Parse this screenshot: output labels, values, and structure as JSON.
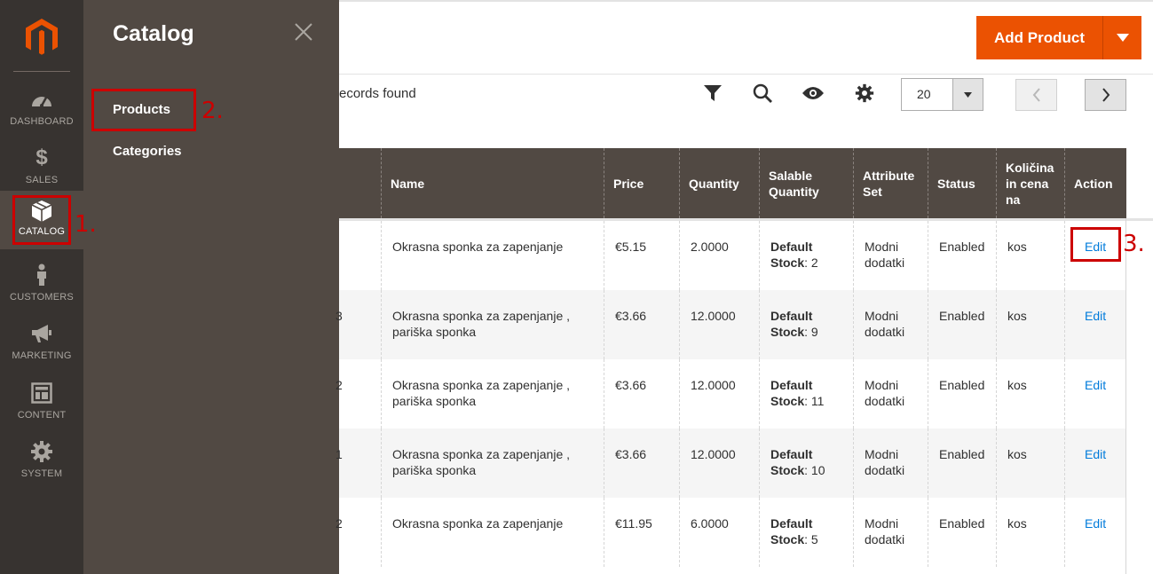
{
  "nav": {
    "items": [
      {
        "name": "dashboard",
        "label": "DASHBOARD",
        "icon": "dashboard-icon"
      },
      {
        "name": "sales",
        "label": "SALES",
        "icon": "dollar-icon"
      },
      {
        "name": "catalog",
        "label": "CATALOG",
        "icon": "box-icon",
        "active": true
      },
      {
        "name": "customers",
        "label": "CUSTOMERS",
        "icon": "person-icon"
      },
      {
        "name": "marketing",
        "label": "MARKETING",
        "icon": "megaphone-icon"
      },
      {
        "name": "content",
        "label": "CONTENT",
        "icon": "layout-icon"
      },
      {
        "name": "system",
        "label": "SYSTEM",
        "icon": "gear-icon"
      }
    ]
  },
  "flyout": {
    "title": "Catalog",
    "links": [
      "Products",
      "Categories"
    ]
  },
  "header": {
    "add_product": "Add Product"
  },
  "toolbar": {
    "records_text": "ecords found",
    "per_page": "20"
  },
  "grid": {
    "columns": [
      "",
      "Name",
      "Price",
      "Quantity",
      "Salable Quantity",
      "Attribute Set",
      "Status",
      "Količina in cena na",
      "Action"
    ],
    "rows": [
      {
        "id_fragment": "",
        "name": "Okrasna sponka za zapenjanje",
        "price": "€5.15",
        "quantity": "2.0000",
        "salable_label": "Default Stock",
        "salable_value": ": 2",
        "attribute_set": "Modni dodatki",
        "status": "Enabled",
        "unit": "kos",
        "action": "Edit"
      },
      {
        "id_fragment": "3",
        "name": "Okrasna sponka za zapenjanje , pariška sponka",
        "price": "€3.66",
        "quantity": "12.0000",
        "salable_label": "Default Stock",
        "salable_value": ": 9",
        "attribute_set": "Modni dodatki",
        "status": "Enabled",
        "unit": "kos",
        "action": "Edit"
      },
      {
        "id_fragment": "2",
        "name": "Okrasna sponka za zapenjanje , pariška sponka",
        "price": "€3.66",
        "quantity": "12.0000",
        "salable_label": "Default Stock",
        "salable_value": ": 11",
        "attribute_set": "Modni dodatki",
        "status": "Enabled",
        "unit": "kos",
        "action": "Edit"
      },
      {
        "id_fragment": "1",
        "name": "Okrasna sponka za zapenjanje , pariška sponka",
        "price": "€3.66",
        "quantity": "12.0000",
        "salable_label": "Default Stock",
        "salable_value": ": 10",
        "attribute_set": "Modni dodatki",
        "status": "Enabled",
        "unit": "kos",
        "action": "Edit"
      },
      {
        "id_fragment": "2",
        "name": "Okrasna sponka za zapenjanje",
        "price": "€11.95",
        "quantity": "6.0000",
        "salable_label": "Default Stock",
        "salable_value": ": 5",
        "attribute_set": "Modni dodatki",
        "status": "Enabled",
        "unit": "kos",
        "action": "Edit"
      }
    ]
  },
  "annotations": [
    "1.",
    "2.",
    "3."
  ],
  "colors": {
    "accent": "#eb5202",
    "nav_bg": "#373330",
    "flyout_bg": "#514943",
    "annotation": "#cc0000",
    "link": "#007bdb"
  }
}
